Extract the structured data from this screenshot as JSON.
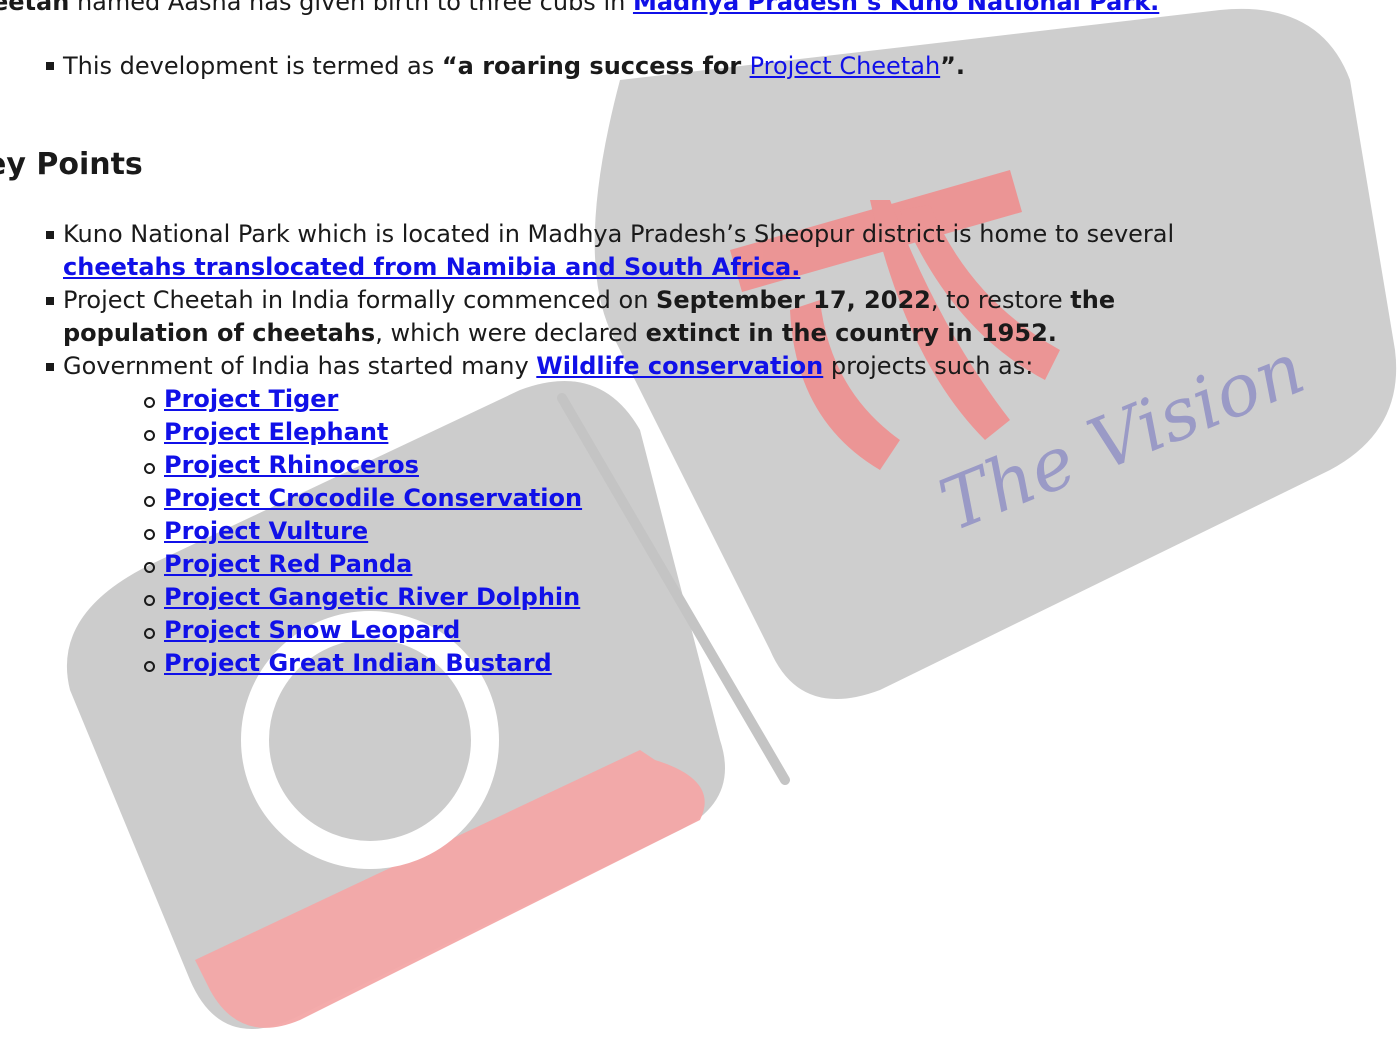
{
  "intro": {
    "bold_start": "eetah",
    "text_mid": " named Aasha has given birth to three cubs in ",
    "link_kuno": "Madhya Pradesh’s Kuno National Park."
  },
  "development": {
    "text_a": "This development is termed as ",
    "bold_a": "“a roaring success for ",
    "link_project_cheetah": "Project Cheetah",
    "bold_b": "”."
  },
  "heading": "ey Points",
  "points": {
    "p1_line1": "Kuno National Park which is located in Madhya Pradesh’s Sheopur district is home to several",
    "p1_link": "cheetahs translocated from Namibia and South Africa.",
    "p2_text_a": "Project Cheetah in India formally commenced on ",
    "p2_bold_date": "September 17, 2022",
    "p2_text_b": ", to restore ",
    "p2_bold_the": "the",
    "p2_bold_population": "population of cheetahs",
    "p2_text_c": ", which were declared ",
    "p2_bold_extinct": "extinct in the country in 1952.",
    "p3_text_a": "Government of India has started many ",
    "p3_link": "Wildlife conservation",
    "p3_text_b": " projects such as:"
  },
  "projects": [
    "Project Tiger",
    "Project Elephant",
    "Project Rhinoceros",
    "Project Crocodile Conservation",
    "Project Vulture",
    "Project Red Panda",
    "Project Gangetic River Dolphin",
    "Project Snow Leopard",
    "Project Great Indian Bustard"
  ],
  "watermark": {
    "text": "The Vision",
    "colors": {
      "gray": "#c8c8c8",
      "red": "#f2a5a5"
    }
  },
  "colors": {
    "link": "#1010e8",
    "text": "#1a1a1a"
  }
}
